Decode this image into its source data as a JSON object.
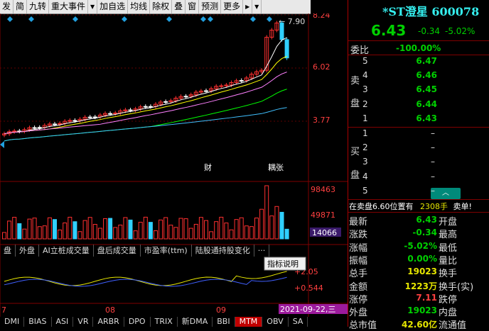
{
  "toolbar": {
    "items": [
      "发",
      "简",
      "九转",
      "重大事件",
      "加自选",
      "均线",
      "除权",
      "叠",
      "窗",
      "预测",
      "更多"
    ]
  },
  "chart": {
    "y_labels": [
      "8.24",
      "6.02",
      "3.77"
    ],
    "high_label": "7.90",
    "events": [
      "财",
      "耦张"
    ],
    "vol_labels": [
      "98463",
      "49871",
      "14066"
    ],
    "macd_labels": [
      "+2.05",
      "+0.544"
    ],
    "x_labels": [
      "7",
      "08",
      "09"
    ],
    "cursor_date": "2021-09-22,三",
    "indicator_tip": "指标说明",
    "colors": {
      "up": "#ff3030",
      "down": "#30d0ff",
      "flat": "#ffffff"
    }
  },
  "indicator_tabs": [
    "盘",
    "外盘",
    "AI立桩成交量",
    "盘后成交量",
    "市盈率(ttm)",
    "陆股通持股变化",
    "···"
  ],
  "bottom_tabs": [
    "DMI",
    "BIAS",
    "ASI",
    "VR",
    "ARBR",
    "DPO",
    "TRIX",
    "新DMA",
    "BBI",
    "MTM",
    "OBV",
    "SA"
  ],
  "active_bottom_tab": "MTM",
  "quote": {
    "name": "*ST澄星 600078",
    "price": "6.43",
    "change": "-0.34",
    "pct": "-5.02%",
    "webi_label": "委比",
    "webi_value": "-100.00%",
    "sell_label": "卖盘",
    "buy_label": "买盘",
    "sell": [
      {
        "lv": "5",
        "p": "6.47"
      },
      {
        "lv": "4",
        "p": "6.46"
      },
      {
        "lv": "3",
        "p": "6.45"
      },
      {
        "lv": "2",
        "p": "6.44"
      },
      {
        "lv": "1",
        "p": "6.43"
      }
    ],
    "buy": [
      {
        "lv": "1",
        "p": "–"
      },
      {
        "lv": "2",
        "p": "–"
      },
      {
        "lv": "3",
        "p": "–"
      },
      {
        "lv": "4",
        "p": "–"
      },
      {
        "lv": "5",
        "p": "–"
      }
    ],
    "notice_a": "在卖盘6.60位置有",
    "notice_b": "2308手",
    "notice_c": "卖单!",
    "stats": [
      {
        "l": "最新",
        "v": "6.43",
        "r": "开盘",
        "c": "g"
      },
      {
        "l": "涨跌",
        "v": "-0.34",
        "r": "最高",
        "c": "g"
      },
      {
        "l": "涨幅",
        "v": "-5.02%",
        "r": "最低",
        "c": "g"
      },
      {
        "l": "振幅",
        "v": "0.00%",
        "r": "量比",
        "c": "g"
      },
      {
        "l": "总手",
        "v": "19023",
        "r": "换手",
        "c": "y"
      },
      {
        "l": "金额",
        "v": "1223万",
        "r": "换手(实)",
        "c": "y"
      },
      {
        "l": "涨停",
        "v": "7.11",
        "r": "跌停",
        "c": "r"
      },
      {
        "l": "外盘",
        "v": "19023",
        "r": "内盘",
        "c": "g"
      },
      {
        "l": "总市值",
        "v": "42.60亿",
        "r": "流通值",
        "c": "y"
      }
    ]
  }
}
